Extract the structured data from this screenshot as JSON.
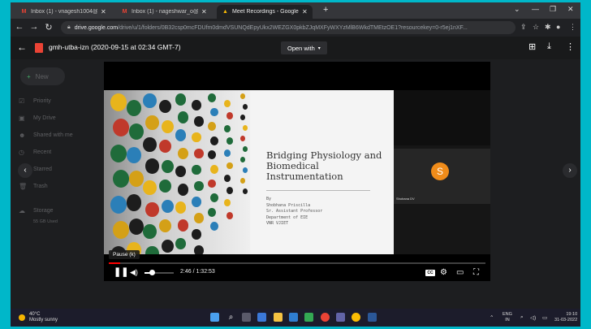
{
  "browser": {
    "tabs": [
      {
        "title": "Inbox (1) - vnagesh1004@gmai...",
        "active": false
      },
      {
        "title": "Inbox (1) - nageshwar_o@vnrvjie...",
        "active": false
      },
      {
        "title": "Meet Recordings - Google D...",
        "active": true
      }
    ],
    "url_host": "drive.google.com",
    "url_path": "/drive/u/1/folders/0B32csp0mcFDUfm0dmdVSUNQdEpyUkx2WEZGX0pkbZJqMXFyWXYzMlB6WkdTMEtzOE1?resourcekey=0-r5ej1nXF..."
  },
  "drive": {
    "new_label": "New",
    "sidebar": [
      "Priority",
      "My Drive",
      "Shared with me",
      "Recent",
      "Starred",
      "Trash"
    ],
    "storage_label": "Storage",
    "storage_used": "55 GB Used"
  },
  "viewer": {
    "file_title": "gmh-utba-izn (2020-09-15 at 02:34 GMT-7)",
    "open_with": "Open with"
  },
  "slide": {
    "title_lines": [
      "Bridging Physiology and",
      "Biomedical",
      "Instrumentation"
    ],
    "byline": [
      "By",
      "Shobhana Priscilla",
      "Sr. Assistant Professor",
      "Department of EIE",
      "VNR VJIET"
    ]
  },
  "meet": {
    "participant_initial": "S",
    "participant_name": "Shobana DV",
    "avatar_color": "#f08c1a"
  },
  "player": {
    "tooltip": "Pause (k)",
    "current_time": "2:46",
    "duration": "1:32:53",
    "time_display": "2:46 / 1:32:53",
    "volume_fraction": 0.25,
    "cc_label": "CC",
    "progress_color": "#ff0000"
  },
  "taskbar": {
    "temperature": "40°C",
    "weather": "Mostly sunny",
    "language": "ENG",
    "region": "IN",
    "time": "19:10",
    "date": "31-03-2022"
  }
}
